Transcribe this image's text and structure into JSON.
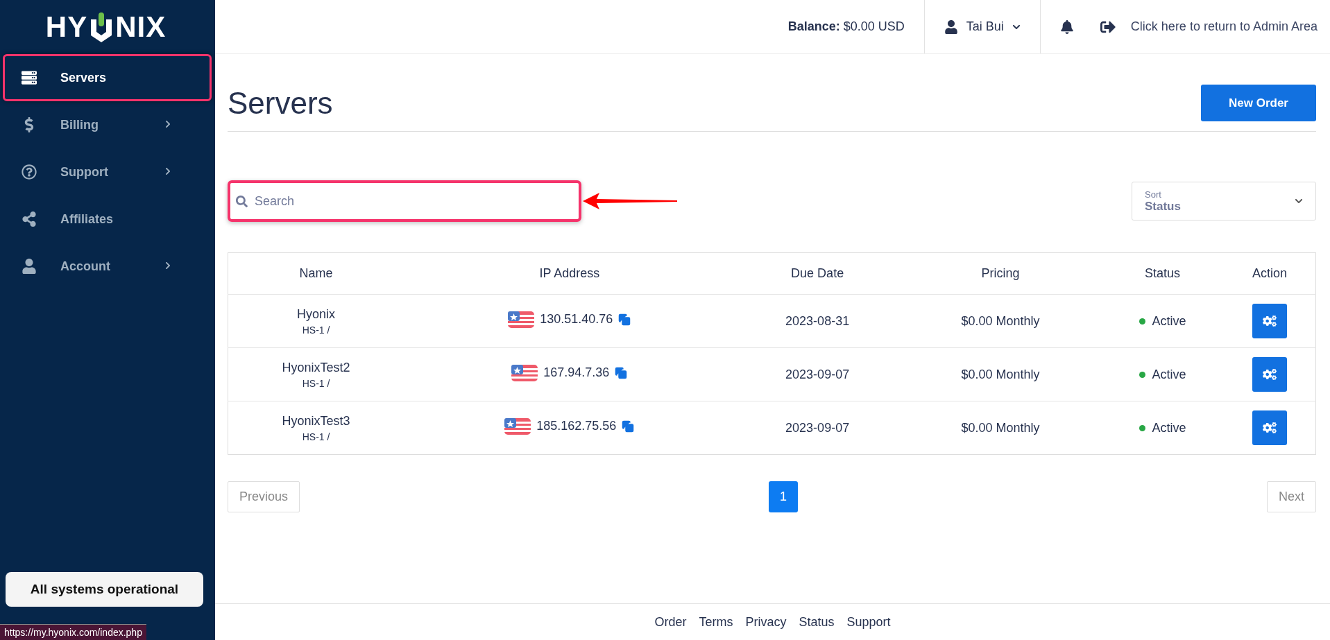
{
  "sidebar": {
    "logo": {
      "left": "HY",
      "right": "NIX"
    },
    "items": [
      {
        "kind": "servers",
        "label": "Servers",
        "selected": true,
        "highlighted": true,
        "has_submenu": false
      },
      {
        "kind": "billing",
        "label": "Billing",
        "selected": false,
        "highlighted": false,
        "has_submenu": true
      },
      {
        "kind": "support",
        "label": "Support",
        "selected": false,
        "highlighted": false,
        "has_submenu": true
      },
      {
        "kind": "affiliates",
        "label": "Affiliates",
        "selected": false,
        "highlighted": false,
        "has_submenu": false
      },
      {
        "kind": "account",
        "label": "Account",
        "selected": false,
        "highlighted": false,
        "has_submenu": true
      }
    ],
    "status_button": "All systems operational"
  },
  "header": {
    "balance_label": "Balance:",
    "balance_value": "$0.00 USD",
    "user": "Tai Bui",
    "admin_link": "Click here to return to Admin Area"
  },
  "page": {
    "title": "Servers",
    "new_order": "New Order"
  },
  "search": {
    "placeholder": "Search",
    "highlighted": true,
    "pointer_arrow": true
  },
  "sort": {
    "label": "Sort",
    "value": "Status"
  },
  "table": {
    "columns": [
      "Name",
      "IP Address",
      "Due Date",
      "Pricing",
      "Status",
      "Action"
    ],
    "rows": [
      {
        "name": "Hyonix",
        "plan": "HS-1 /",
        "ip": "130.51.40.76",
        "due": "2023-08-31",
        "pricing": "$0.00 Monthly",
        "status": "Active",
        "color": "#28a745"
      },
      {
        "name": "HyonixTest2",
        "plan": "HS-1 /",
        "ip": "167.94.7.36",
        "due": "2023-09-07",
        "pricing": "$0.00 Monthly",
        "status": "Active",
        "color": "#28a745"
      },
      {
        "name": "HyonixTest3",
        "plan": "HS-1 /",
        "ip": "185.162.75.56",
        "due": "2023-09-07",
        "pricing": "$0.00 Monthly",
        "status": "Active",
        "color": "#28a745"
      }
    ]
  },
  "pagination": {
    "previous": "Previous",
    "next": "Next",
    "pages": [
      {
        "label": "1",
        "selected": true
      }
    ]
  },
  "footer": {
    "links": [
      "Order",
      "Terms",
      "Privacy",
      "Status",
      "Support"
    ]
  },
  "browser_status_url": "https://my.hyonix.com/index.php"
}
